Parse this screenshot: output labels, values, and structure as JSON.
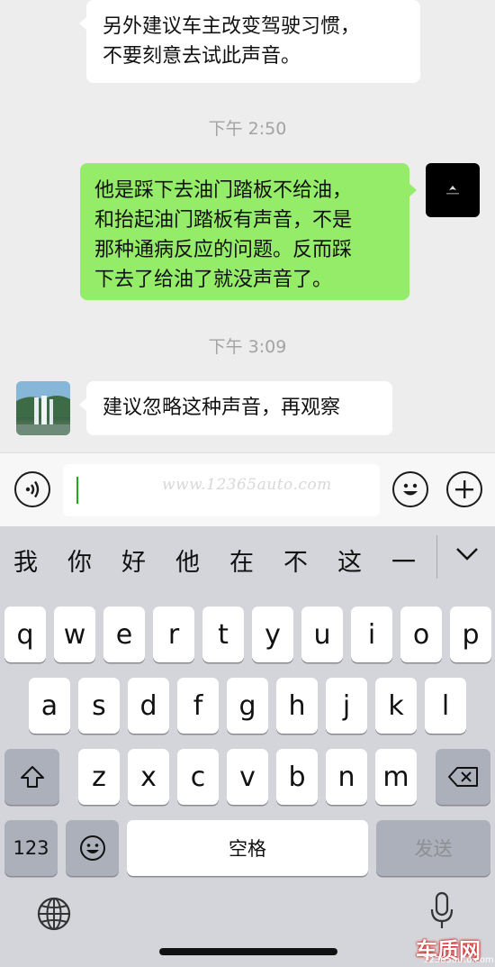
{
  "chat": {
    "messages": [
      {
        "side": "left",
        "lines": [
          "另外建议车主改变驾驶习惯，",
          "不要刻意去试此声音。"
        ]
      },
      {
        "timestamp": "下午 2:50"
      },
      {
        "side": "right",
        "lines": [
          "他是踩下去油门踏板不给油，",
          "和抬起油门踏板有声音，不是",
          "那种通病反应的问题。反而踩",
          "下去了给油了就没声音了。"
        ]
      },
      {
        "timestamp": "下午 3:09"
      },
      {
        "side": "left",
        "lines": [
          "建议忽略这种声音，再观察"
        ]
      }
    ]
  },
  "input_bar": {
    "voice_icon": "voice-icon",
    "emoji_icon": "emoji-icon",
    "plus_icon": "plus-icon",
    "watermark": "www.12365auto.com"
  },
  "keyboard": {
    "candidates": [
      "我",
      "你",
      "好",
      "他",
      "在",
      "不",
      "这",
      "一"
    ],
    "row1": [
      "q",
      "w",
      "e",
      "r",
      "t",
      "y",
      "u",
      "i",
      "o",
      "p"
    ],
    "row2": [
      "a",
      "s",
      "d",
      "f",
      "g",
      "h",
      "j",
      "k",
      "l"
    ],
    "row3": [
      "z",
      "x",
      "c",
      "v",
      "b",
      "n",
      "m"
    ],
    "numbers_key": "123",
    "space_key": "空格",
    "send_key": "发送"
  },
  "logo": {
    "main": "车质网",
    "sub": "12365auto.com"
  },
  "colors": {
    "sent_bubble": "#95ec69",
    "received_bubble": "#ffffff",
    "background": "#ededed"
  }
}
